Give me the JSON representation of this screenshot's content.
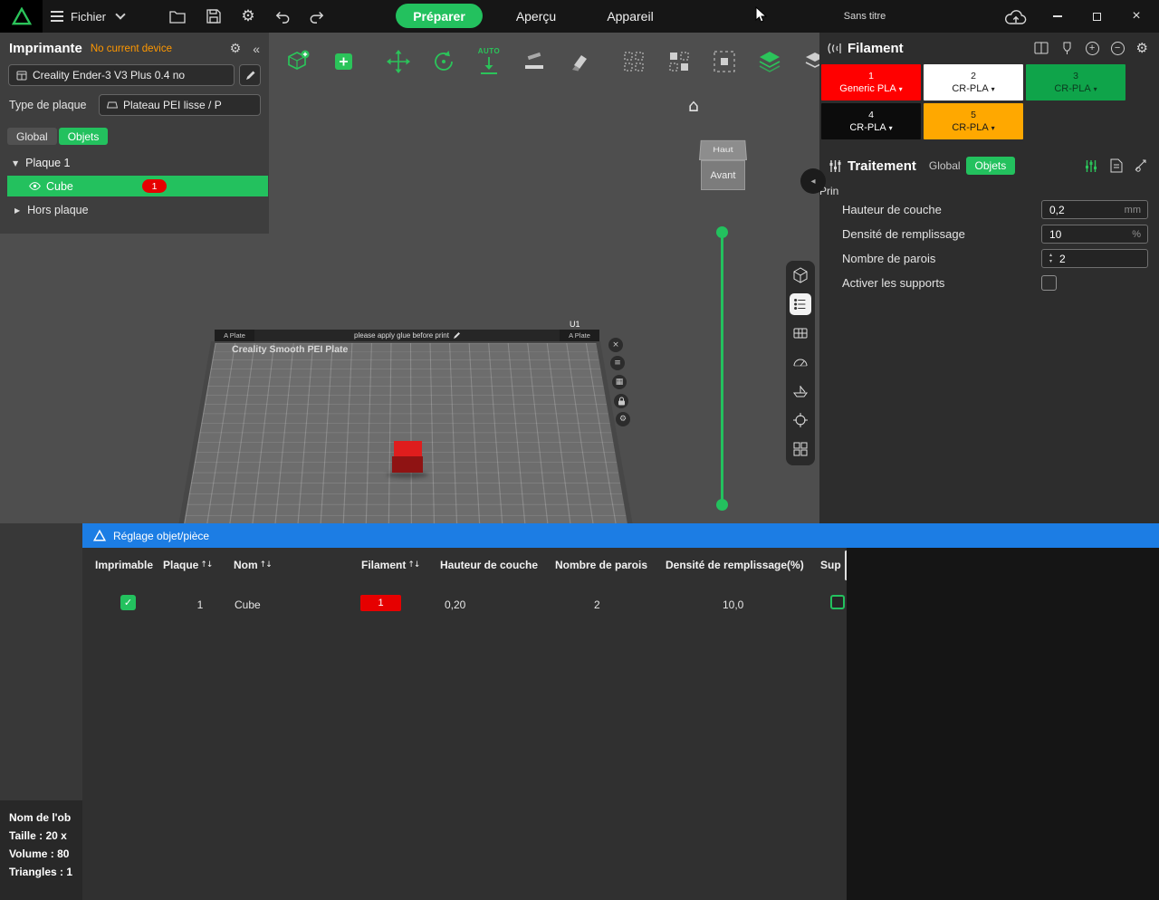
{
  "colors": {
    "green": "#23C15E",
    "blue": "#1C7DE4",
    "red": "#E60000",
    "orange": "#FF9800"
  },
  "icons": {
    "gear": "⚙",
    "collapse_panel": "«",
    "caret_down": "▾",
    "sort": "↑↓",
    "check": "✓",
    "close": "×",
    "menu_lines": "≡",
    "grid": "▦",
    "home": "⌂",
    "tree_open": "▼",
    "tree_closed": "▶",
    "step_up": "▴",
    "step_down": "▾",
    "panel_collapse_left": "◂",
    "plus": "+",
    "minus": "−"
  },
  "titlebar": {
    "menu_label": "Fichier",
    "tabs": [
      {
        "label": "Préparer",
        "active": true
      },
      {
        "label": "Aperçu",
        "active": false
      },
      {
        "label": "Appareil",
        "active": false
      }
    ],
    "document_title": "Sans titre"
  },
  "printer_panel": {
    "title": "Imprimante",
    "status": "No current device",
    "printer_name": "Creality Ender-3 V3 Plus 0.4 no",
    "plate_type_label": "Type de plaque",
    "plate_type_value": "Plateau PEI lisse / P",
    "tabs": {
      "global": "Global",
      "objects": "Objets"
    },
    "tree": {
      "plate_label": "Plaque 1",
      "object_label": "Cube",
      "object_badge": "1",
      "off_plate_label": "Hors plaque"
    }
  },
  "viewport": {
    "auto_label": "AUTO",
    "plate_brand": "Creality Smooth PEI Plate",
    "plate_hint": "please apply glue before print",
    "plate_corner_left": "A Plate",
    "plate_corner_right": "A Plate",
    "plate_tag": "U1",
    "navcube": {
      "top": "Haut",
      "front": "Avant"
    }
  },
  "toolbars": {
    "main": [
      "add-model",
      "add-plate",
      "move",
      "rotate",
      "auto-orient",
      "lay-on-face",
      "seam-paint",
      "clone",
      "arrange",
      "select-region",
      "layers",
      "split"
    ],
    "view_strip": [
      "view-cube",
      "object-list",
      "grid",
      "gauge",
      "platform",
      "locate",
      "parts"
    ],
    "plate_actions": [
      "close",
      "menu",
      "grid",
      "lock",
      "settings"
    ]
  },
  "filament_panel": {
    "title": "Filament",
    "slots": [
      {
        "index": "1",
        "material": "Generic PLA",
        "bg": "#FF0000",
        "fg": "#FFFFFF"
      },
      {
        "index": "2",
        "material": "CR-PLA",
        "bg": "#FFFFFF",
        "fg": "#1A1A1A"
      },
      {
        "index": "3",
        "material": "CR-PLA",
        "bg": "#0FA44A",
        "fg": "#0B3B20"
      },
      {
        "index": "4",
        "material": "CR-PLA",
        "bg": "#0C0C0C",
        "fg": "#FFFFFF"
      },
      {
        "index": "5",
        "material": "CR-PLA",
        "bg": "#FFA800",
        "fg": "#1A1A1A"
      }
    ]
  },
  "process_panel": {
    "title": "Traitement",
    "tabs": {
      "global": "Global",
      "objects": "Objets"
    },
    "clipped_label": "Prin",
    "settings": [
      {
        "label": "Hauteur de couche",
        "value": "0,2",
        "unit": "mm",
        "type": "input"
      },
      {
        "label": "Densité de remplissage",
        "value": "10",
        "unit": "%",
        "type": "input"
      },
      {
        "label": "Nombre de parois",
        "value": "2",
        "type": "stepper"
      },
      {
        "label": "Activer les supports",
        "type": "checkbox",
        "checked": false
      }
    ]
  },
  "object_table": {
    "title": "Réglage objet/pièce",
    "columns": [
      {
        "label": "Imprimable",
        "sortable": false
      },
      {
        "label": "Plaque",
        "sortable": true
      },
      {
        "label": "Nom",
        "sortable": true
      },
      {
        "label": "Filament",
        "sortable": true
      },
      {
        "label": "Hauteur de couche",
        "sortable": false
      },
      {
        "label": "Nombre de parois",
        "sortable": false
      },
      {
        "label": "Densité de remplissage(%)",
        "sortable": false
      },
      {
        "label": "Sup",
        "sortable": false
      }
    ],
    "row": {
      "printable": true,
      "plate": "1",
      "name": "Cube",
      "filament_index": "1",
      "filament_color": "#E60000",
      "layer_height": "0,20",
      "walls": "2",
      "infill": "10,0",
      "support": false
    }
  },
  "object_info": {
    "lines": [
      "Nom de l'ob",
      "Taille : 20 x",
      "Volume : 80",
      "Triangles : 1"
    ]
  }
}
